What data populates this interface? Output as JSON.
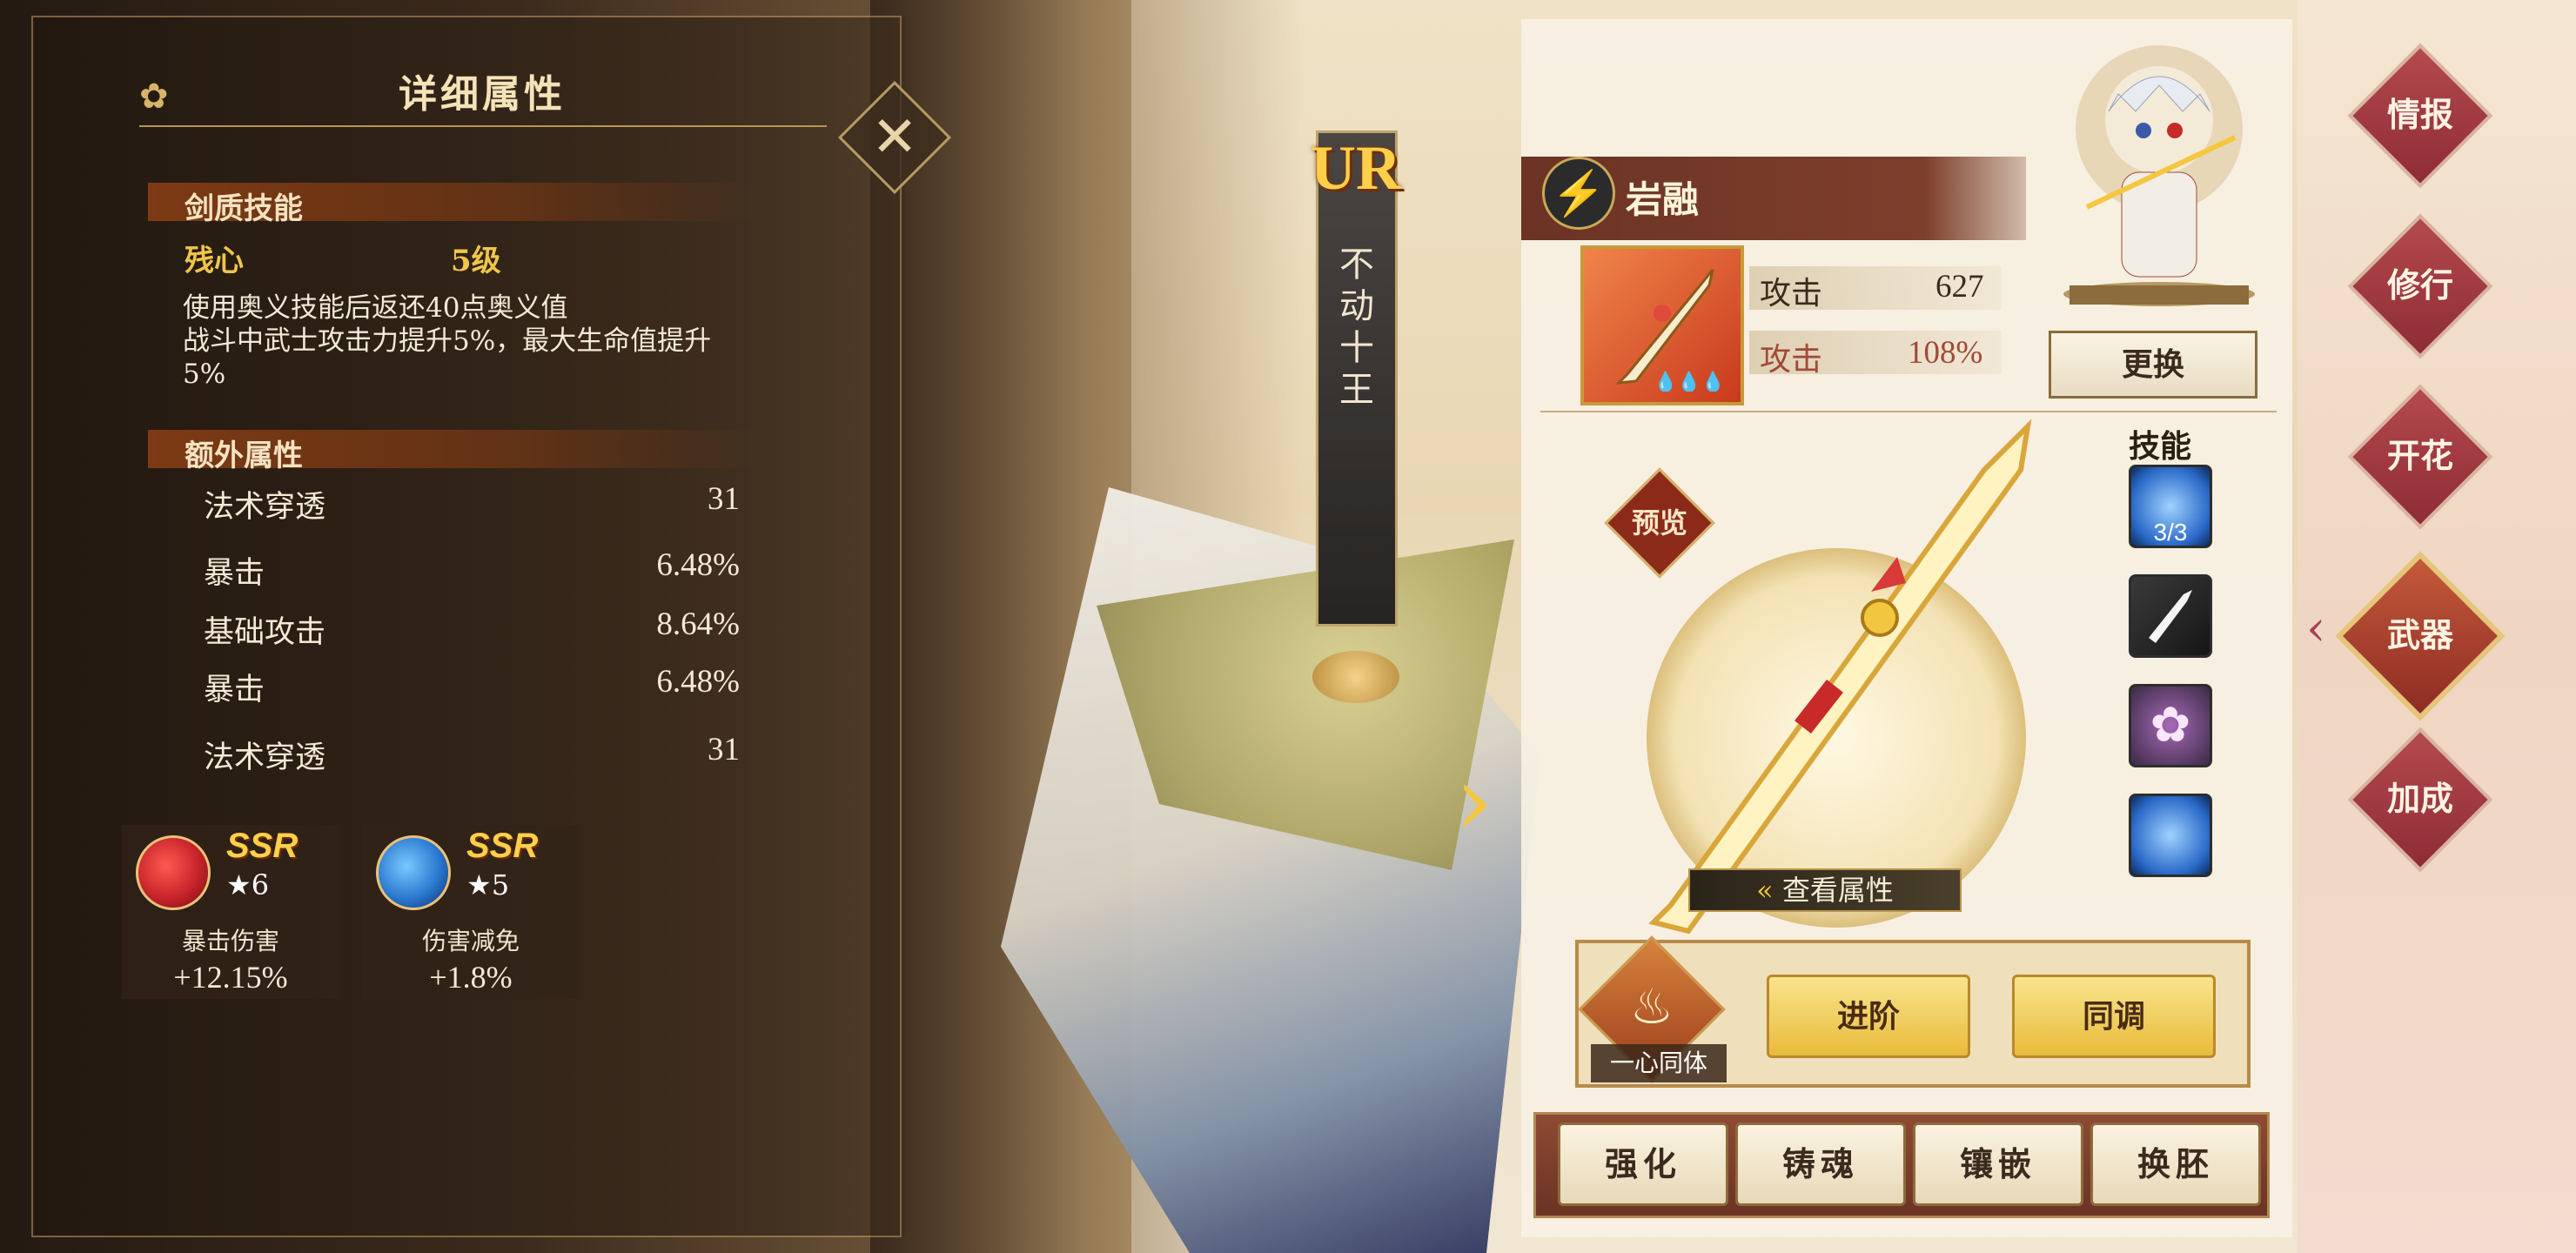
{
  "detail_panel": {
    "title": "详细属性",
    "skill_section": {
      "header": "剑质技能",
      "skill_name": "残心",
      "skill_level": "5级",
      "description_line1": "使用奥义技能后返还40点奥义值",
      "description_line2": "战斗中武士攻击力提升5%，最大生命值提升",
      "description_line3": "5%"
    },
    "extra_section": {
      "header": "额外属性",
      "stats": [
        {
          "name": "法术穿透",
          "value": "31"
        },
        {
          "name": "暴击",
          "value": "6.48%"
        },
        {
          "name": "基础攻击",
          "value": "8.64%"
        },
        {
          "name": "暴击",
          "value": "6.48%"
        },
        {
          "name": "法术穿透",
          "value": "31"
        }
      ]
    },
    "souls": [
      {
        "rarity": "SSR",
        "stars": "★6",
        "label": "暴击伤害",
        "value": "+12.15%",
        "color": "#c8242a"
      },
      {
        "rarity": "SSR",
        "stars": "★5",
        "label": "伤害减免",
        "value": "+1.8%",
        "color": "#2a7ad0"
      }
    ]
  },
  "character": {
    "rarity_badge": "UR",
    "name_vertical": "不动十王"
  },
  "weapon": {
    "name": "岩融",
    "attributes": [
      {
        "label": "攻击",
        "value": "627"
      },
      {
        "label": "攻击",
        "value": "108%"
      }
    ],
    "swap_label": "更换",
    "skills_title": "技能",
    "skill1_count": "3/3",
    "preview_label": "预览",
    "view_attr_label": "查看属性",
    "heart_label": "一心同体",
    "advance_label": "进阶",
    "sync_label": "同调"
  },
  "tabs": [
    "强化",
    "铸魂",
    "镶嵌",
    "换胚"
  ],
  "nav": [
    {
      "label": "情报",
      "active": false
    },
    {
      "label": "修行",
      "active": false
    },
    {
      "label": "开花",
      "active": false
    },
    {
      "label": "武器",
      "active": true
    },
    {
      "label": "加成",
      "active": false
    }
  ],
  "colors": {
    "gold": "#f0c54a",
    "nav_red": "#8e2c34",
    "brown_bar": "#6b3324"
  }
}
